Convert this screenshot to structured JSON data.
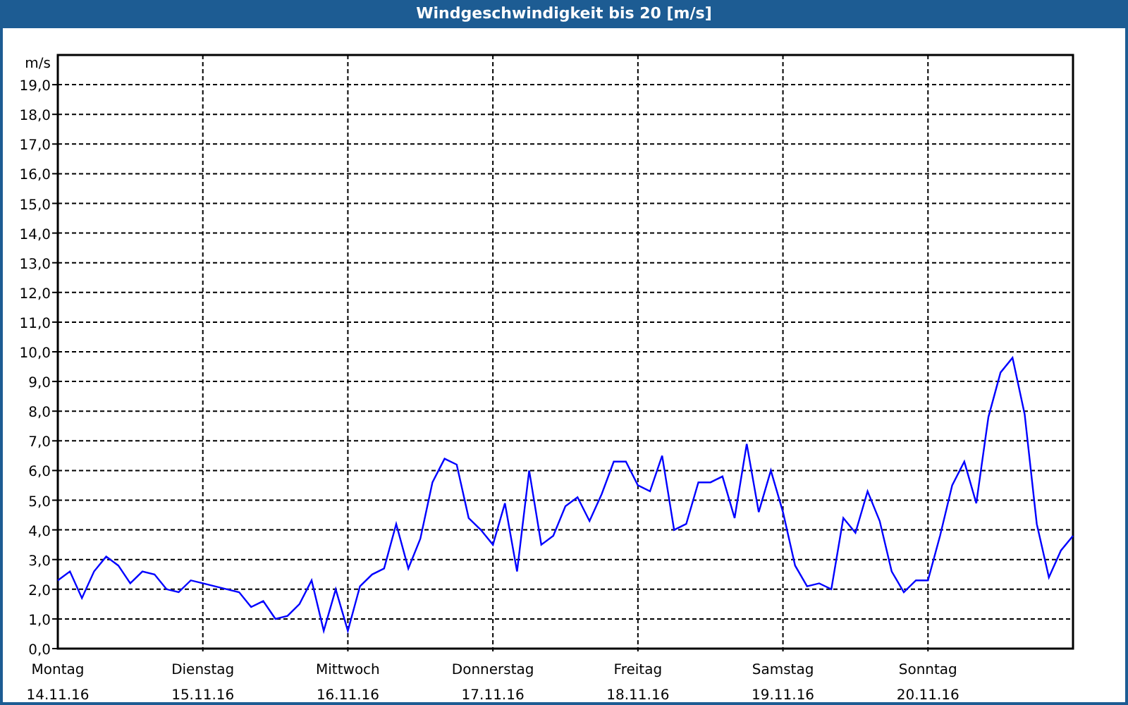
{
  "panel": {
    "title": "Windgeschwindigkeit bis 20 [m/s]",
    "chart_data": {
      "type": "line",
      "grid": true,
      "ylabel": "m/s",
      "ylim": [
        0,
        20
      ],
      "yticks": [
        {
          "value": 0,
          "label": "0,0"
        },
        {
          "value": 1,
          "label": "1,0"
        },
        {
          "value": 2,
          "label": "2,0"
        },
        {
          "value": 3,
          "label": "3,0"
        },
        {
          "value": 4,
          "label": "4,0"
        },
        {
          "value": 5,
          "label": "5,0"
        },
        {
          "value": 6,
          "label": "6,0"
        },
        {
          "value": 7,
          "label": "7,0"
        },
        {
          "value": 8,
          "label": "8,0"
        },
        {
          "value": 9,
          "label": "9,0"
        },
        {
          "value": 10,
          "label": "10,0"
        },
        {
          "value": 11,
          "label": "11,0"
        },
        {
          "value": 12,
          "label": "12,0"
        },
        {
          "value": 13,
          "label": "13,0"
        },
        {
          "value": 14,
          "label": "14,0"
        },
        {
          "value": 15,
          "label": "15,0"
        },
        {
          "value": 16,
          "label": "16,0"
        },
        {
          "value": 17,
          "label": "17,0"
        },
        {
          "value": 18,
          "label": "18,0"
        },
        {
          "value": 19,
          "label": "19,0"
        }
      ],
      "categories": [
        "Montag\n14.11.16",
        null,
        null,
        null,
        null,
        null,
        null,
        null,
        null,
        null,
        null,
        null,
        "Dienstag\n15.11.16",
        null,
        null,
        null,
        null,
        null,
        null,
        null,
        null,
        null,
        null,
        null,
        "Mittwoch\n16.11.16",
        null,
        null,
        null,
        null,
        null,
        null,
        null,
        null,
        null,
        null,
        null,
        "Donnerstag\n17.11.16",
        null,
        null,
        null,
        null,
        null,
        null,
        null,
        null,
        null,
        null,
        null,
        "Freitag\n18.11.16",
        null,
        null,
        null,
        null,
        null,
        null,
        null,
        null,
        null,
        null,
        null,
        "Samstag\n19.11.16",
        null,
        null,
        null,
        null,
        null,
        null,
        null,
        null,
        null,
        null,
        null,
        "Sonntag\n20.11.16",
        null,
        null,
        null,
        null,
        null,
        null,
        null,
        null,
        null,
        null,
        null,
        null
      ],
      "series": [
        {
          "color": "#0000ff",
          "values": [
            2.3,
            2.6,
            1.7,
            2.6,
            3.1,
            2.8,
            2.2,
            2.6,
            2.5,
            2.0,
            1.9,
            2.3,
            2.2,
            2.1,
            2.0,
            1.9,
            1.4,
            1.6,
            1.0,
            1.1,
            1.5,
            2.3,
            0.6,
            2.0,
            0.6,
            2.1,
            2.5,
            2.7,
            4.2,
            2.7,
            3.7,
            5.6,
            6.4,
            6.2,
            4.4,
            4.0,
            3.5,
            4.9,
            2.6,
            6.0,
            3.5,
            3.8,
            4.8,
            5.1,
            4.3,
            5.2,
            6.3,
            6.3,
            5.5,
            5.3,
            6.5,
            4.0,
            4.2,
            5.6,
            5.6,
            5.8,
            4.4,
            6.9,
            4.6,
            6.0,
            4.6,
            2.8,
            2.1,
            2.2,
            2.0,
            4.4,
            3.9,
            5.3,
            4.3,
            2.6,
            1.9,
            2.3,
            2.3,
            3.8,
            5.5,
            6.3,
            4.9,
            7.8,
            9.3,
            9.8,
            7.9,
            4.2,
            2.4,
            3.3,
            3.8
          ]
        }
      ]
    }
  }
}
